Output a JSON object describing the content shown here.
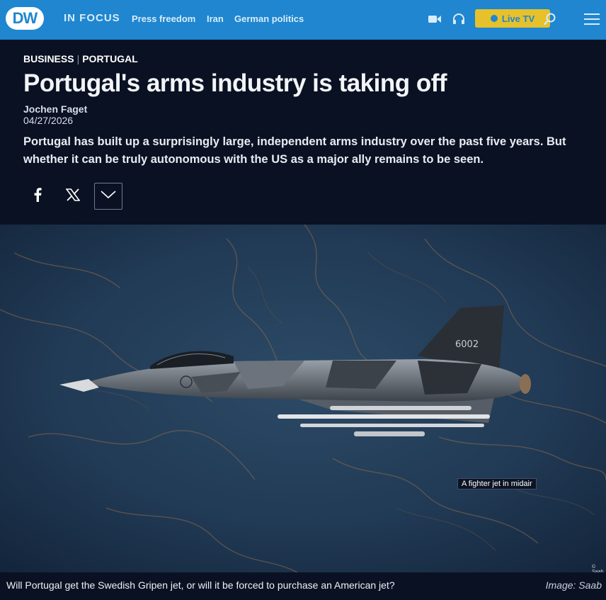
{
  "header": {
    "logo_text": "DW",
    "in_focus": "IN FOCUS",
    "nav_links": [
      "Press freedom",
      "Iran",
      "German politics"
    ],
    "live_label": "Live TV",
    "brand_color": "#1f86cf",
    "live_color": "#e6c12c"
  },
  "article": {
    "kicker_section": "BUSINESS",
    "kicker_sep": "|",
    "kicker_region": "PORTUGAL",
    "title": "Portugal's arms industry is taking off",
    "author": "Jochen Faget",
    "date": "04/27/2026",
    "lead": "Portugal has built up a surprisingly large, independent arms industry over the past five years. But whether it can be truly autonomous with the US as a major ally remains to be seen."
  },
  "share": {
    "icons": [
      "facebook-icon",
      "x-icon",
      "chevron-down-icon"
    ]
  },
  "image": {
    "tail_number": "6002",
    "alt_badge": "A fighter jet in midair",
    "copyright": "© Saab",
    "caption": "Will Portugal get the Swedish Gripen jet, or will it be forced to purchase an American jet?",
    "credit": "Image: Saab"
  }
}
